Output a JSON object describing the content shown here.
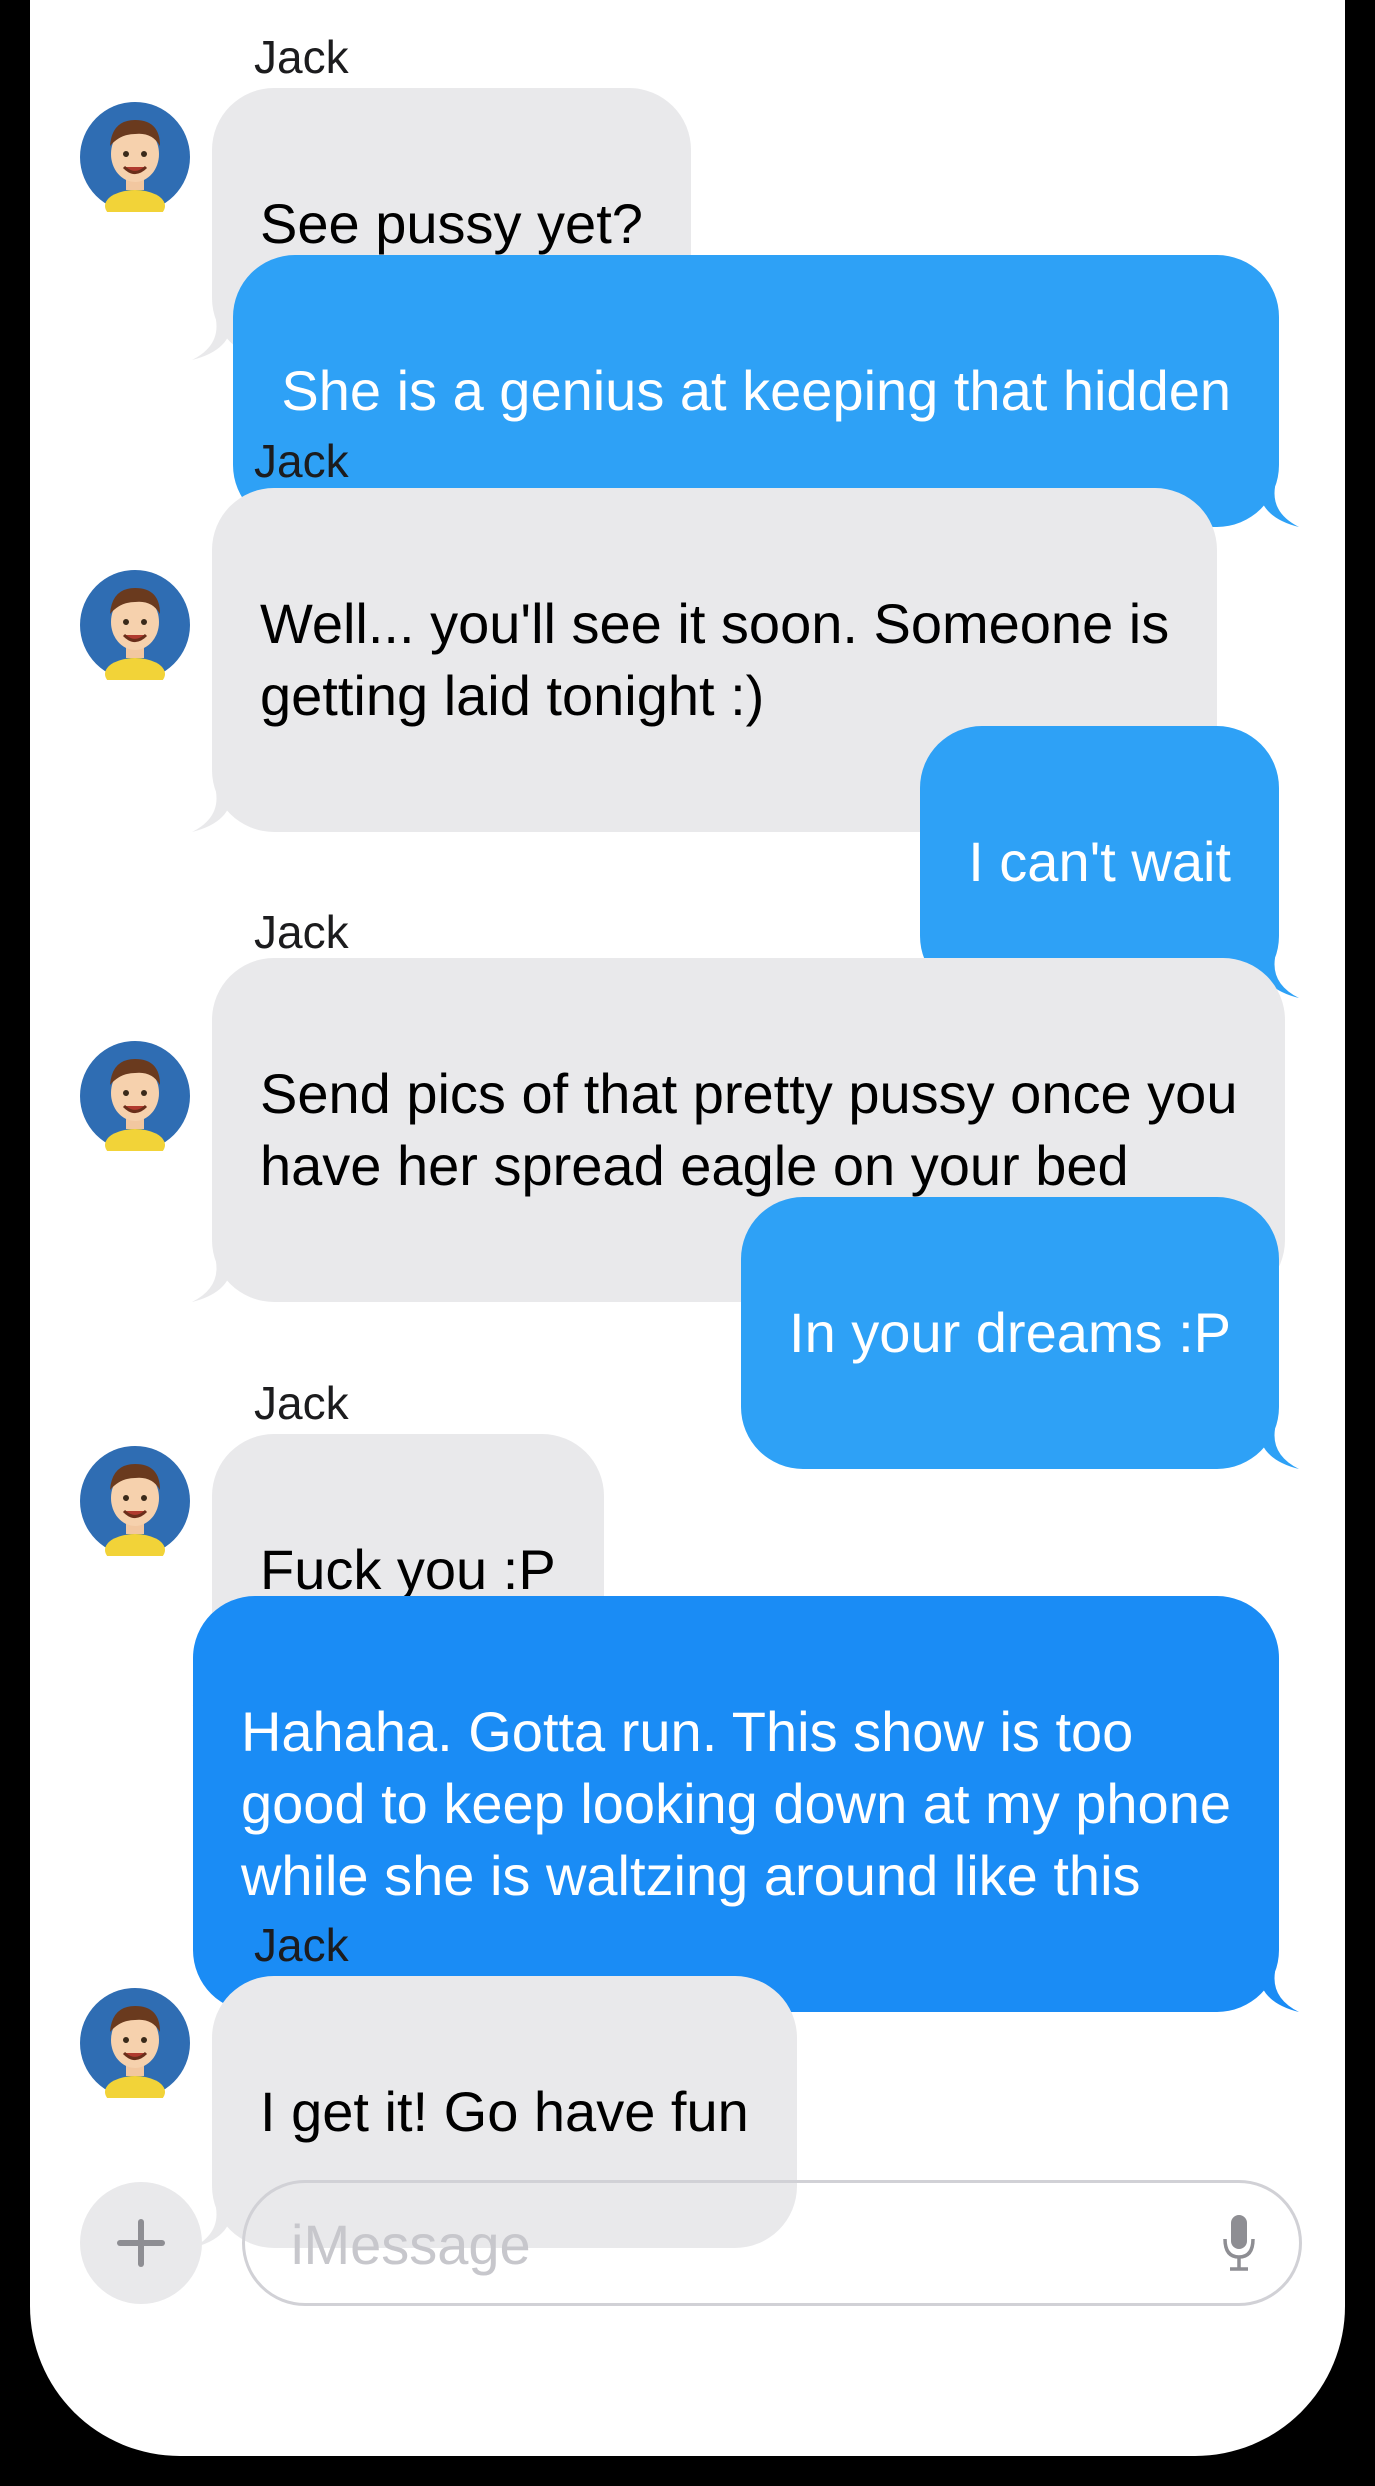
{
  "conversation": {
    "messages": [
      {
        "from": "Jack",
        "text": "See pussy yet?"
      },
      {
        "from": "me",
        "text": "She is a genius at keeping that hidden"
      },
      {
        "from": "Jack",
        "text": "Well... you'll see it soon.  Someone is\ngetting laid tonight :)"
      },
      {
        "from": "me",
        "text": "I can't wait"
      },
      {
        "from": "Jack",
        "text": "Send pics of that pretty pussy once you\nhave her spread eagle on your bed"
      },
      {
        "from": "me",
        "text": "In your dreams :P"
      },
      {
        "from": "Jack",
        "text": "Fuck you :P"
      },
      {
        "from": "me",
        "text": "Hahaha.  Gotta run.  This show is too\ngood to keep looking down at my phone\nwhile she is waltzing around like this"
      },
      {
        "from": "Jack",
        "text": "I get it!  Go have fun"
      }
    ]
  },
  "composer": {
    "placeholder": "iMessage",
    "add_icon": "plus-icon",
    "mic_icon": "microphone-icon"
  },
  "colors": {
    "sent_bubble": "#2ea1f6",
    "sent_bubble_last": "#1a8cf5",
    "received_bubble": "#e9e9eb",
    "frame": "#000000"
  }
}
